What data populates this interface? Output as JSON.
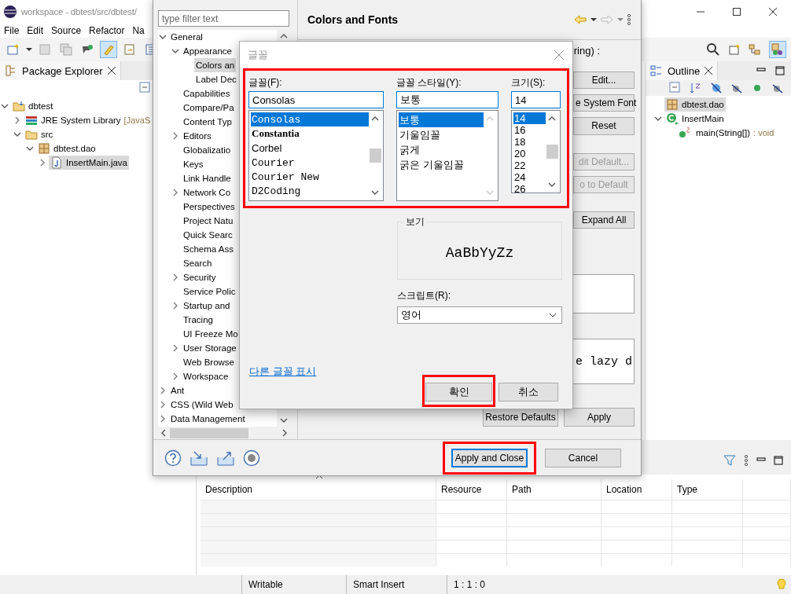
{
  "ide": {
    "title": "workspace - dbtest/src/dbtest/",
    "menu": [
      "File",
      "Edit",
      "Source",
      "Refactor",
      "Na"
    ],
    "package_explorer": {
      "tab": "Package Explorer",
      "tree": [
        {
          "label": "dbtest",
          "kind": "project",
          "expanded": true,
          "selected": false,
          "children": [
            {
              "label": "JRE System Library",
              "suffix": "[JavaS",
              "kind": "library",
              "expanded": false,
              "selected": false
            },
            {
              "label": "src",
              "kind": "folder",
              "expanded": true,
              "selected": false,
              "children": [
                {
                  "label": "dbtest.dao",
                  "kind": "package",
                  "expanded": true,
                  "selected": false,
                  "children": [
                    {
                      "label": "InsertMain.java",
                      "kind": "file",
                      "expanded": false,
                      "selected": true
                    }
                  ]
                }
              ]
            }
          ]
        }
      ]
    },
    "outline": {
      "tab": "Outline",
      "tree": [
        {
          "label": "dbtest.dao",
          "kind": "package",
          "selected": true
        },
        {
          "label": "InsertMain",
          "kind": "class",
          "expanded": true,
          "selected": false,
          "children": [
            {
              "label": "main(String[])",
              "suffix": ": void",
              "kind": "method",
              "selected": false
            }
          ]
        }
      ]
    },
    "problems": {
      "columns": [
        "Description",
        "Resource",
        "Path",
        "Location",
        "Type"
      ]
    },
    "status_bar": [
      "Writable",
      "Smart Insert",
      "1 : 1 : 0"
    ]
  },
  "preferences": {
    "filter": {
      "placeholder": "type filter text"
    },
    "tree": [
      {
        "label": "General",
        "expanded": true,
        "selected": false,
        "children": [
          {
            "label": "Appearance",
            "expanded": true,
            "selected": false,
            "children": [
              {
                "label": "Colors an",
                "selected": true
              },
              {
                "label": "Label Dec",
                "selected": false
              }
            ]
          },
          {
            "label": "Capabilities",
            "selected": false
          },
          {
            "label": "Compare/Pa",
            "selected": false
          },
          {
            "label": "Content Typ",
            "selected": false
          },
          {
            "label": "Editors",
            "expanded": false,
            "selected": false
          },
          {
            "label": "Globalizatio",
            "selected": false
          },
          {
            "label": "Keys",
            "selected": false
          },
          {
            "label": "Link Handle",
            "selected": false
          },
          {
            "label": "Network Co",
            "expanded": false,
            "selected": false
          },
          {
            "label": "Perspectives",
            "selected": false
          },
          {
            "label": "Project Natu",
            "selected": false
          },
          {
            "label": "Quick Searc",
            "selected": false
          },
          {
            "label": "Schema Ass",
            "selected": false
          },
          {
            "label": "Search",
            "selected": false
          },
          {
            "label": "Security",
            "expanded": false,
            "selected": false
          },
          {
            "label": "Service Polic",
            "selected": false
          },
          {
            "label": "Startup and",
            "expanded": false,
            "selected": false
          },
          {
            "label": "Tracing",
            "selected": false
          },
          {
            "label": "UI Freeze Mo",
            "selected": false
          },
          {
            "label": "User Storage",
            "expanded": false,
            "selected": false
          },
          {
            "label": "Web Browse",
            "selected": false
          },
          {
            "label": "Workspace",
            "expanded": false,
            "selected": false
          }
        ]
      },
      {
        "label": "Ant",
        "expanded": false,
        "selected": false
      },
      {
        "label": "CSS (Wild Web",
        "expanded": false,
        "selected": false
      },
      {
        "label": "Data Management",
        "expanded": false,
        "selected": false
      }
    ],
    "page": {
      "title": "Colors and Fonts",
      "description": "ring) :",
      "buttons": [
        {
          "label": "Edit...",
          "disabled": false
        },
        {
          "label": "e System Font",
          "disabled": false
        },
        {
          "label": "Reset",
          "disabled": false
        },
        {
          "label": "dit Default...",
          "disabled": true
        },
        {
          "label": "o to Default",
          "disabled": true
        },
        {
          "label": "Expand All",
          "disabled": false
        }
      ],
      "preview": "e lazy d",
      "bottom_buttons": [
        "Restore Defaults",
        "Apply"
      ]
    },
    "footer_buttons": [
      {
        "label": "Apply and Close",
        "default": true,
        "highlighted": true
      },
      {
        "label": "Cancel",
        "default": false,
        "highlighted": false
      }
    ]
  },
  "font_dialog": {
    "title": "글꼴",
    "highlighted": true,
    "font": {
      "label": "글꼴(F):",
      "value": "Consolas",
      "items": [
        {
          "label": "Consolas",
          "kind": "mono",
          "selected": true
        },
        {
          "label": "Constantia",
          "kind": "serif",
          "selected": false
        },
        {
          "label": "Corbel",
          "kind": "sans",
          "selected": false
        },
        {
          "label": "Courier",
          "kind": "mono",
          "selected": false
        },
        {
          "label": "Courier New",
          "kind": "mono",
          "selected": false
        },
        {
          "label": "D2Coding",
          "kind": "mono",
          "selected": false
        }
      ]
    },
    "style": {
      "label": "글꼴 스타일(Y):",
      "value": "보통",
      "items": [
        {
          "label": "보통",
          "selected": true
        },
        {
          "label": "기울임꼴",
          "selected": false
        },
        {
          "label": "굵게",
          "selected": false
        },
        {
          "label": "굵은 기울임꼴",
          "selected": false
        }
      ]
    },
    "size": {
      "label": "크기(S):",
      "value": "14",
      "items": [
        {
          "label": "14",
          "selected": true
        },
        {
          "label": "16",
          "selected": false
        },
        {
          "label": "18",
          "selected": false
        },
        {
          "label": "20",
          "selected": false
        },
        {
          "label": "22",
          "selected": false
        },
        {
          "label": "24",
          "selected": false
        },
        {
          "label": "26",
          "selected": false
        }
      ]
    },
    "sample": {
      "label": "보기",
      "text": "AaBbYyZz"
    },
    "script": {
      "label": "스크립트(R):",
      "value": "영어"
    },
    "link": "다른 글꼴 표시",
    "buttons": [
      {
        "label": "확인",
        "highlighted": true
      },
      {
        "label": "취소",
        "highlighted": false
      }
    ]
  }
}
